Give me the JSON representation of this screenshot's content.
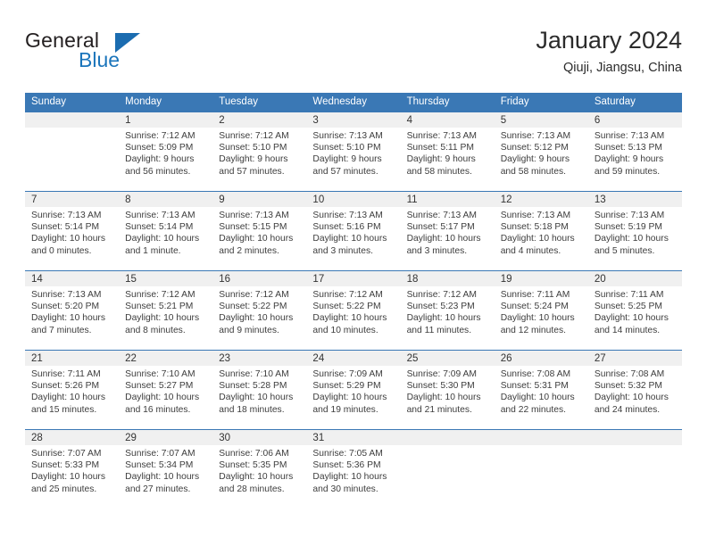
{
  "brand": {
    "name_part1": "General",
    "name_part2": "Blue",
    "triangle_color": "#1b6cb0",
    "blue_color": "#1b75bb"
  },
  "header": {
    "title": "January 2024",
    "subtitle": "Qiuji, Jiangsu, China"
  },
  "theme": {
    "header_bg": "#3a78b5",
    "daynum_bg": "#f0f0f0",
    "separator": "#3a78b5",
    "text": "#3d3d3d"
  },
  "weekdays": [
    "Sunday",
    "Monday",
    "Tuesday",
    "Wednesday",
    "Thursday",
    "Friday",
    "Saturday"
  ],
  "labels": {
    "sunrise": "Sunrise:",
    "sunset": "Sunset:",
    "daylight": "Daylight:"
  },
  "weeks": [
    [
      {
        "day": ""
      },
      {
        "day": "1",
        "sunrise": "Sunrise: 7:12 AM",
        "sunset": "Sunset: 5:09 PM",
        "daylight1": "Daylight: 9 hours",
        "daylight2": "and 56 minutes."
      },
      {
        "day": "2",
        "sunrise": "Sunrise: 7:12 AM",
        "sunset": "Sunset: 5:10 PM",
        "daylight1": "Daylight: 9 hours",
        "daylight2": "and 57 minutes."
      },
      {
        "day": "3",
        "sunrise": "Sunrise: 7:13 AM",
        "sunset": "Sunset: 5:10 PM",
        "daylight1": "Daylight: 9 hours",
        "daylight2": "and 57 minutes."
      },
      {
        "day": "4",
        "sunrise": "Sunrise: 7:13 AM",
        "sunset": "Sunset: 5:11 PM",
        "daylight1": "Daylight: 9 hours",
        "daylight2": "and 58 minutes."
      },
      {
        "day": "5",
        "sunrise": "Sunrise: 7:13 AM",
        "sunset": "Sunset: 5:12 PM",
        "daylight1": "Daylight: 9 hours",
        "daylight2": "and 58 minutes."
      },
      {
        "day": "6",
        "sunrise": "Sunrise: 7:13 AM",
        "sunset": "Sunset: 5:13 PM",
        "daylight1": "Daylight: 9 hours",
        "daylight2": "and 59 minutes."
      }
    ],
    [
      {
        "day": "7",
        "sunrise": "Sunrise: 7:13 AM",
        "sunset": "Sunset: 5:14 PM",
        "daylight1": "Daylight: 10 hours",
        "daylight2": "and 0 minutes."
      },
      {
        "day": "8",
        "sunrise": "Sunrise: 7:13 AM",
        "sunset": "Sunset: 5:14 PM",
        "daylight1": "Daylight: 10 hours",
        "daylight2": "and 1 minute."
      },
      {
        "day": "9",
        "sunrise": "Sunrise: 7:13 AM",
        "sunset": "Sunset: 5:15 PM",
        "daylight1": "Daylight: 10 hours",
        "daylight2": "and 2 minutes."
      },
      {
        "day": "10",
        "sunrise": "Sunrise: 7:13 AM",
        "sunset": "Sunset: 5:16 PM",
        "daylight1": "Daylight: 10 hours",
        "daylight2": "and 3 minutes."
      },
      {
        "day": "11",
        "sunrise": "Sunrise: 7:13 AM",
        "sunset": "Sunset: 5:17 PM",
        "daylight1": "Daylight: 10 hours",
        "daylight2": "and 3 minutes."
      },
      {
        "day": "12",
        "sunrise": "Sunrise: 7:13 AM",
        "sunset": "Sunset: 5:18 PM",
        "daylight1": "Daylight: 10 hours",
        "daylight2": "and 4 minutes."
      },
      {
        "day": "13",
        "sunrise": "Sunrise: 7:13 AM",
        "sunset": "Sunset: 5:19 PM",
        "daylight1": "Daylight: 10 hours",
        "daylight2": "and 5 minutes."
      }
    ],
    [
      {
        "day": "14",
        "sunrise": "Sunrise: 7:13 AM",
        "sunset": "Sunset: 5:20 PM",
        "daylight1": "Daylight: 10 hours",
        "daylight2": "and 7 minutes."
      },
      {
        "day": "15",
        "sunrise": "Sunrise: 7:12 AM",
        "sunset": "Sunset: 5:21 PM",
        "daylight1": "Daylight: 10 hours",
        "daylight2": "and 8 minutes."
      },
      {
        "day": "16",
        "sunrise": "Sunrise: 7:12 AM",
        "sunset": "Sunset: 5:22 PM",
        "daylight1": "Daylight: 10 hours",
        "daylight2": "and 9 minutes."
      },
      {
        "day": "17",
        "sunrise": "Sunrise: 7:12 AM",
        "sunset": "Sunset: 5:22 PM",
        "daylight1": "Daylight: 10 hours",
        "daylight2": "and 10 minutes."
      },
      {
        "day": "18",
        "sunrise": "Sunrise: 7:12 AM",
        "sunset": "Sunset: 5:23 PM",
        "daylight1": "Daylight: 10 hours",
        "daylight2": "and 11 minutes."
      },
      {
        "day": "19",
        "sunrise": "Sunrise: 7:11 AM",
        "sunset": "Sunset: 5:24 PM",
        "daylight1": "Daylight: 10 hours",
        "daylight2": "and 12 minutes."
      },
      {
        "day": "20",
        "sunrise": "Sunrise: 7:11 AM",
        "sunset": "Sunset: 5:25 PM",
        "daylight1": "Daylight: 10 hours",
        "daylight2": "and 14 minutes."
      }
    ],
    [
      {
        "day": "21",
        "sunrise": "Sunrise: 7:11 AM",
        "sunset": "Sunset: 5:26 PM",
        "daylight1": "Daylight: 10 hours",
        "daylight2": "and 15 minutes."
      },
      {
        "day": "22",
        "sunrise": "Sunrise: 7:10 AM",
        "sunset": "Sunset: 5:27 PM",
        "daylight1": "Daylight: 10 hours",
        "daylight2": "and 16 minutes."
      },
      {
        "day": "23",
        "sunrise": "Sunrise: 7:10 AM",
        "sunset": "Sunset: 5:28 PM",
        "daylight1": "Daylight: 10 hours",
        "daylight2": "and 18 minutes."
      },
      {
        "day": "24",
        "sunrise": "Sunrise: 7:09 AM",
        "sunset": "Sunset: 5:29 PM",
        "daylight1": "Daylight: 10 hours",
        "daylight2": "and 19 minutes."
      },
      {
        "day": "25",
        "sunrise": "Sunrise: 7:09 AM",
        "sunset": "Sunset: 5:30 PM",
        "daylight1": "Daylight: 10 hours",
        "daylight2": "and 21 minutes."
      },
      {
        "day": "26",
        "sunrise": "Sunrise: 7:08 AM",
        "sunset": "Sunset: 5:31 PM",
        "daylight1": "Daylight: 10 hours",
        "daylight2": "and 22 minutes."
      },
      {
        "day": "27",
        "sunrise": "Sunrise: 7:08 AM",
        "sunset": "Sunset: 5:32 PM",
        "daylight1": "Daylight: 10 hours",
        "daylight2": "and 24 minutes."
      }
    ],
    [
      {
        "day": "28",
        "sunrise": "Sunrise: 7:07 AM",
        "sunset": "Sunset: 5:33 PM",
        "daylight1": "Daylight: 10 hours",
        "daylight2": "and 25 minutes."
      },
      {
        "day": "29",
        "sunrise": "Sunrise: 7:07 AM",
        "sunset": "Sunset: 5:34 PM",
        "daylight1": "Daylight: 10 hours",
        "daylight2": "and 27 minutes."
      },
      {
        "day": "30",
        "sunrise": "Sunrise: 7:06 AM",
        "sunset": "Sunset: 5:35 PM",
        "daylight1": "Daylight: 10 hours",
        "daylight2": "and 28 minutes."
      },
      {
        "day": "31",
        "sunrise": "Sunrise: 7:05 AM",
        "sunset": "Sunset: 5:36 PM",
        "daylight1": "Daylight: 10 hours",
        "daylight2": "and 30 minutes."
      },
      {
        "day": ""
      },
      {
        "day": ""
      },
      {
        "day": ""
      }
    ]
  ]
}
